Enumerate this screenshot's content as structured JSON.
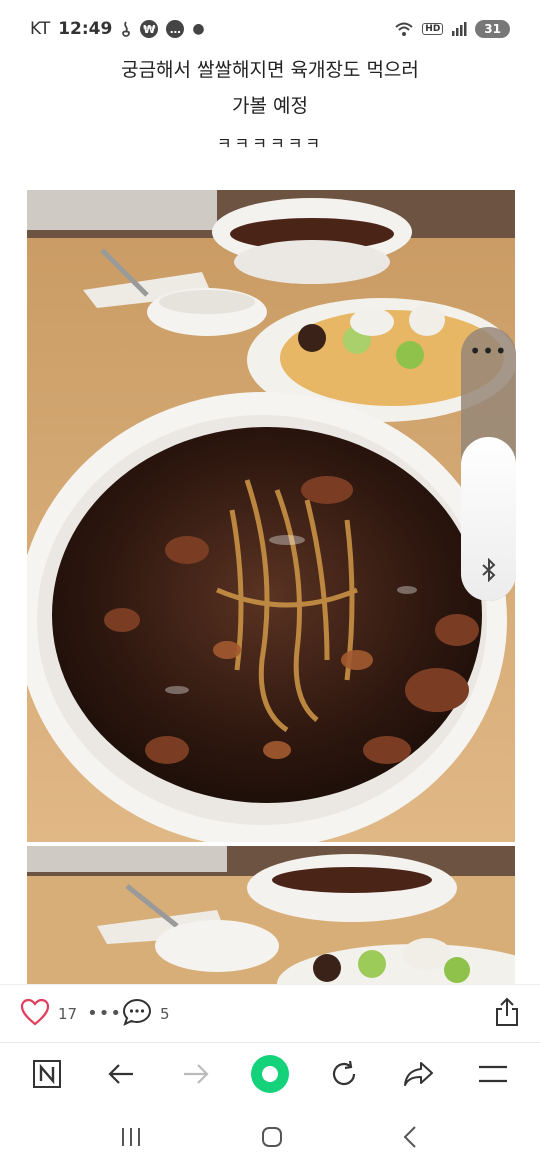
{
  "status_bar": {
    "carrier": "KT",
    "time": "12:49",
    "network_label": "HD",
    "battery": "31"
  },
  "post": {
    "lines": [
      "궁금해서 쌀쌀해지면 육개장도 먹으러",
      "가볼 예정",
      "ㅋㅋㅋㅋㅋㅋ"
    ]
  },
  "actions": {
    "likes": "17",
    "comments": "5"
  },
  "icons": {
    "like": "heart-icon",
    "more": "more-dots-icon",
    "comment": "comment-icon",
    "share": "share-icon",
    "naver": "naver-home-icon",
    "back": "back-arrow-icon",
    "forward": "forward-arrow-icon",
    "green_dot": "green-circle-icon",
    "refresh": "refresh-icon",
    "share_forward": "share-arrow-icon",
    "menu": "hamburger-menu-icon",
    "bluetooth": "bluetooth-icon"
  },
  "colors": {
    "heart": "#e0405c",
    "green": "#13d27a",
    "sauce": "#3a1f14"
  }
}
